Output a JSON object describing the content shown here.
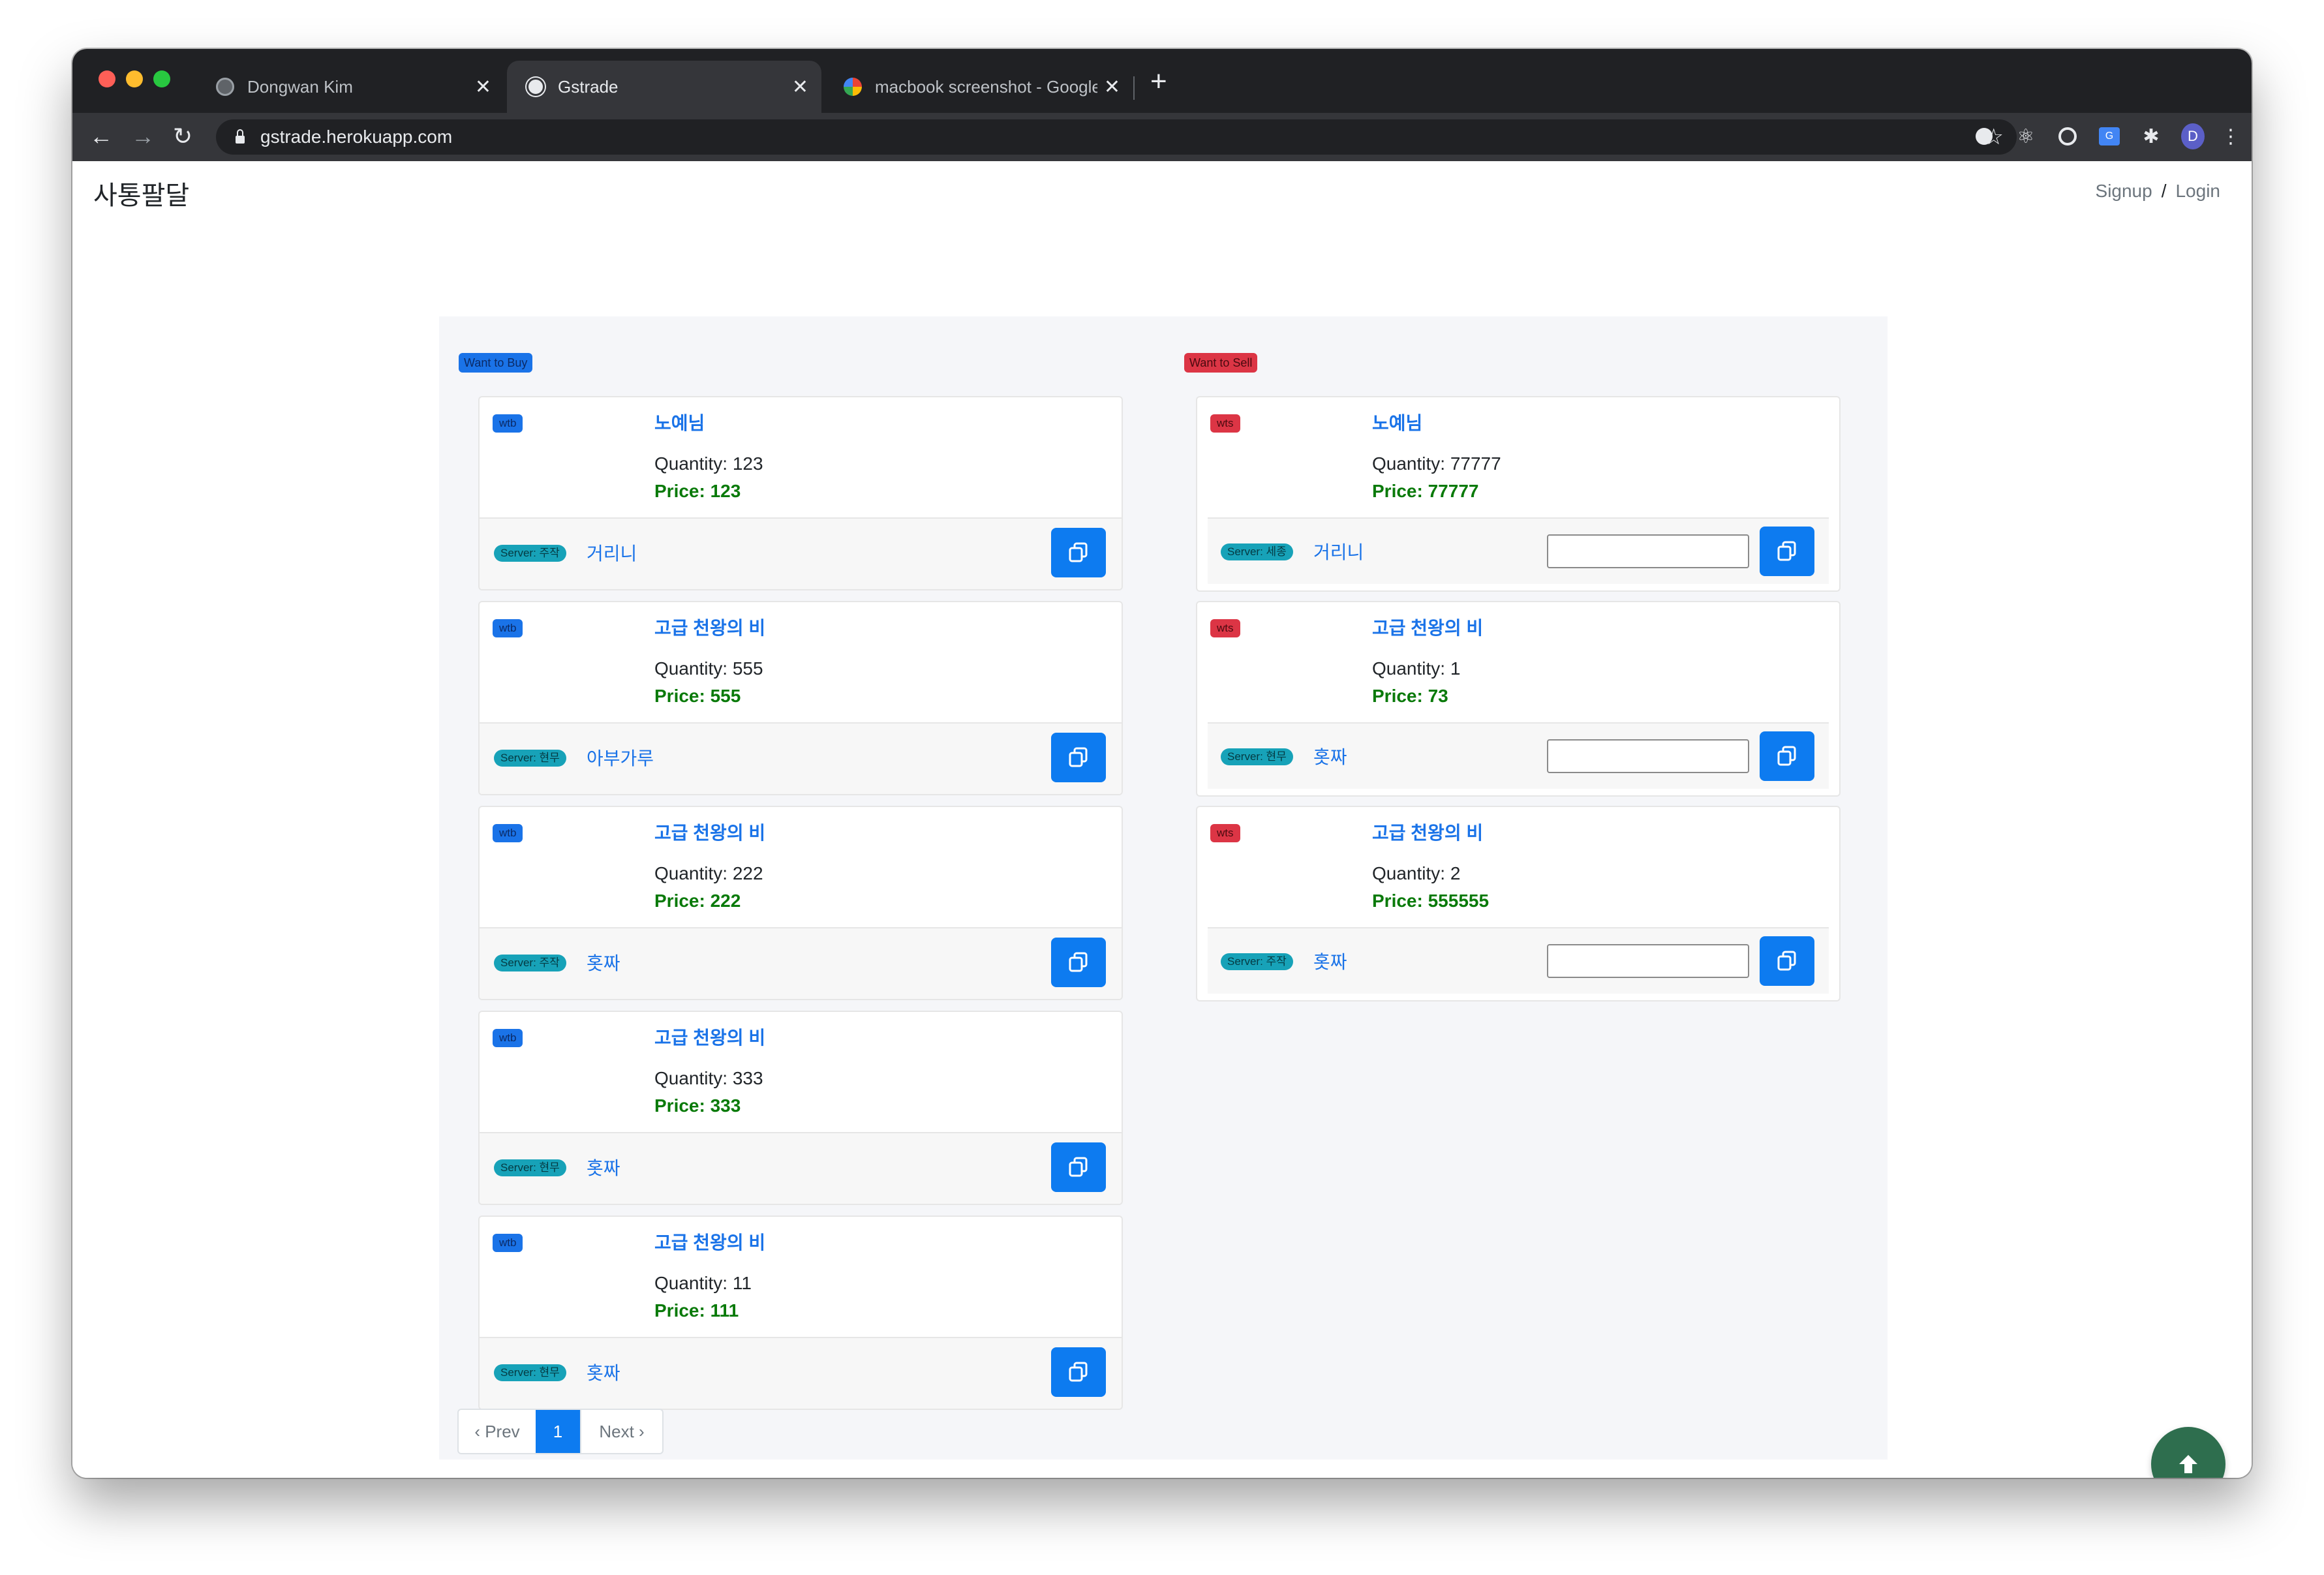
{
  "browser": {
    "tabs": [
      {
        "title": "Dongwan Kim",
        "active": false,
        "favicon": "globe-icon"
      },
      {
        "title": "Gstrade",
        "active": true,
        "favicon": "globe-icon"
      },
      {
        "title": "macbook screenshot - Google",
        "active": false,
        "favicon": "google-icon"
      }
    ],
    "new_tab": "+",
    "close_glyph": "✕",
    "url": "gstrade.herokuapp.com",
    "avatar_initial": "D"
  },
  "navbar": {
    "brand": "사통팔달",
    "signup": "Signup",
    "separator": "/",
    "login": "Login"
  },
  "buy_section": {
    "label": "Want to Buy",
    "items": [
      {
        "type": "wtb",
        "name": "노예님",
        "quantity": "Quantity: 123",
        "price": "Price: 123",
        "server": "Server: 주작",
        "seller": "거리니"
      },
      {
        "type": "wtb",
        "name": "고급 천왕의 비",
        "quantity": "Quantity: 555",
        "price": "Price: 555",
        "server": "Server: 현무",
        "seller": "아부가루"
      },
      {
        "type": "wtb",
        "name": "고급 천왕의 비",
        "quantity": "Quantity: 222",
        "price": "Price: 222",
        "server": "Server: 주작",
        "seller": "홋짜"
      },
      {
        "type": "wtb",
        "name": "고급 천왕의 비",
        "quantity": "Quantity: 333",
        "price": "Price: 333",
        "server": "Server: 현무",
        "seller": "홋짜"
      },
      {
        "type": "wtb",
        "name": "고급 천왕의 비",
        "quantity": "Quantity: 11",
        "price": "Price: 111",
        "server": "Server: 현무",
        "seller": "홋짜"
      }
    ]
  },
  "sell_section": {
    "label": "Want to Sell",
    "items": [
      {
        "type": "wts",
        "name": "노예님",
        "quantity": "Quantity: 77777",
        "price": "Price: 77777",
        "server": "Server: 세종",
        "seller": "거리니",
        "input_value": ""
      },
      {
        "type": "wts",
        "name": "고급 천왕의 비",
        "quantity": "Quantity: 1",
        "price": "Price: 73",
        "server": "Server: 현무",
        "seller": "홋짜",
        "input_value": ""
      },
      {
        "type": "wts",
        "name": "고급 천왕의 비",
        "quantity": "Quantity: 2",
        "price": "Price: 555555",
        "server": "Server: 주작",
        "seller": "홋짜",
        "input_value": ""
      }
    ]
  },
  "pagination": {
    "prev": "‹ Prev",
    "current": "1",
    "next": "Next ›"
  },
  "colors": {
    "primary": "#0d7bf0",
    "danger": "#dc3545",
    "info": "#17a2b8",
    "price_green": "#0a7a0a",
    "scroll_top": "#2e6e4e"
  }
}
